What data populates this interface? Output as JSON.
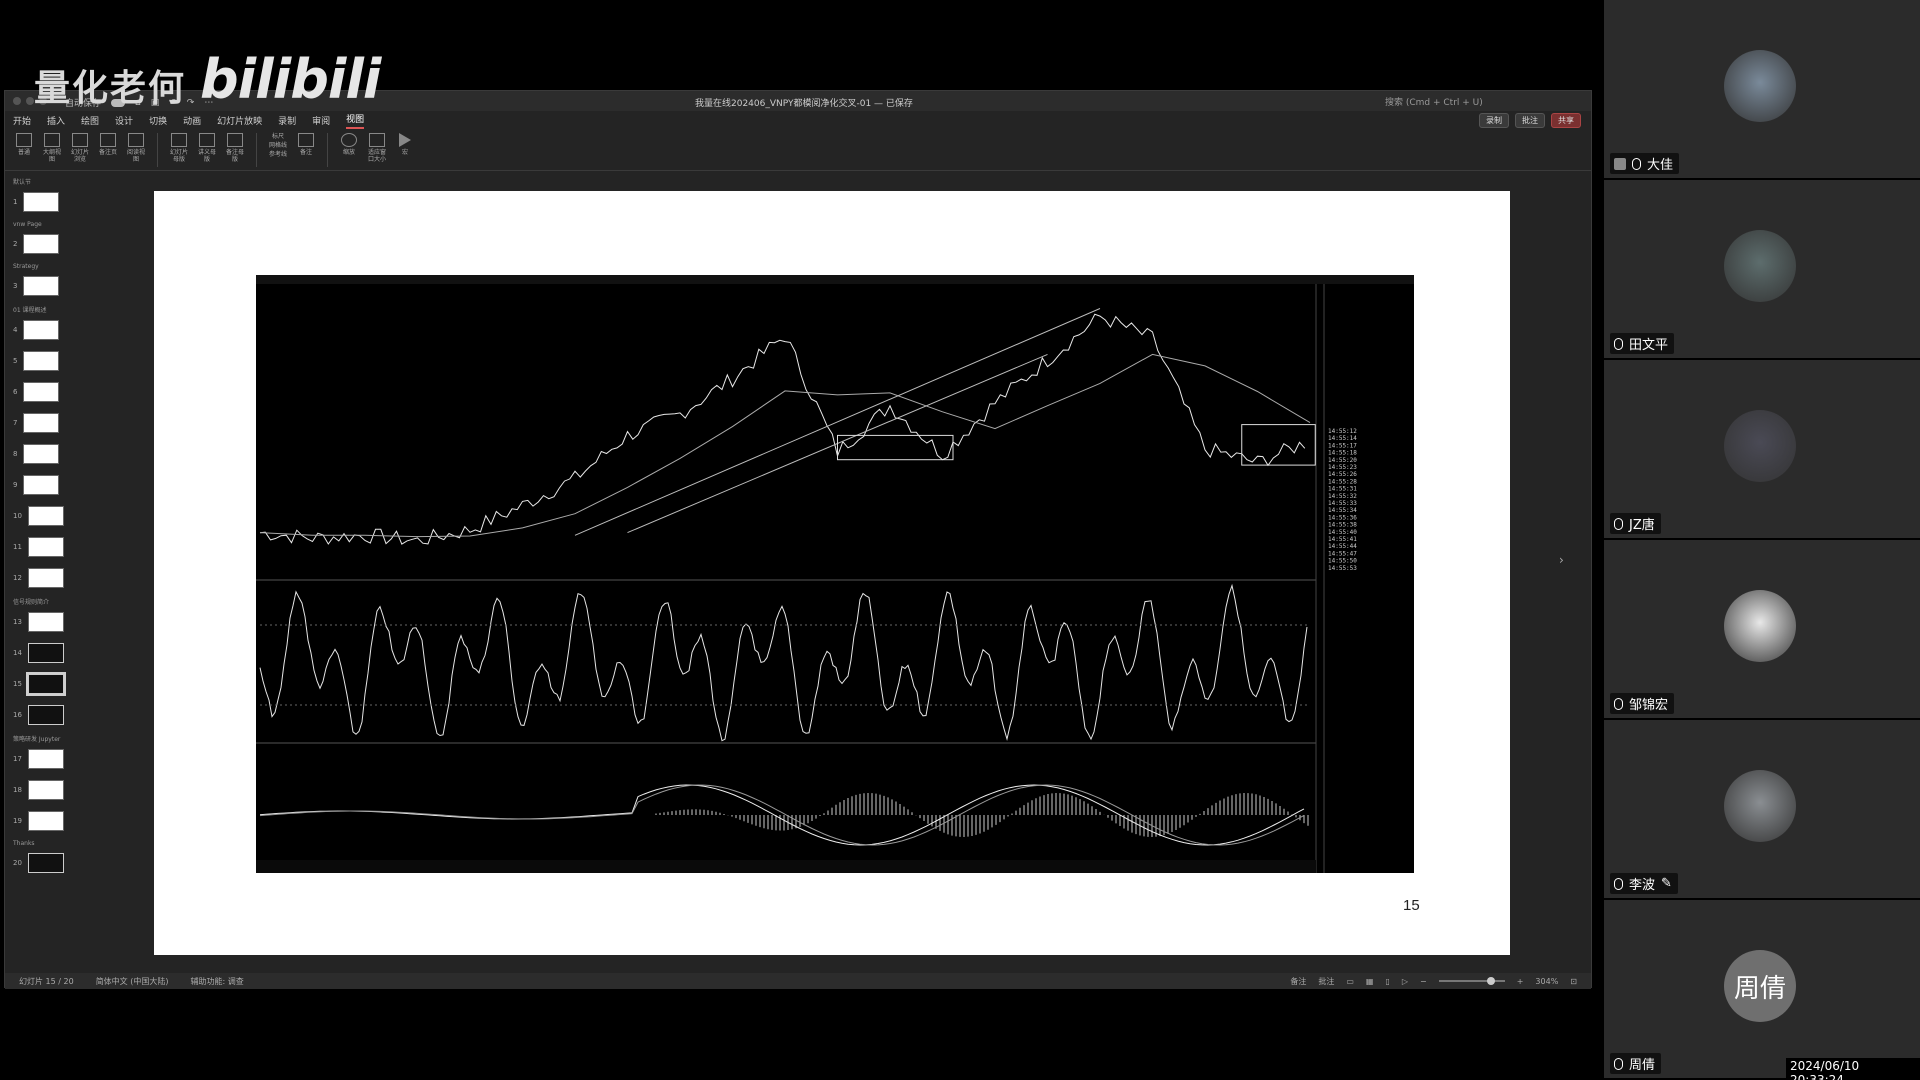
{
  "watermark": {
    "channel": "量化老何",
    "logo": "bilibili"
  },
  "ppt": {
    "title": "我量在线202406_VNPY都模阅净化交叉-01 — 已保存",
    "autosave_label": "自动保存",
    "search_placeholder": "搜索 (Cmd + Ctrl + U)",
    "menu": [
      "开始",
      "插入",
      "绘图",
      "设计",
      "切换",
      "动画",
      "幻灯片放映",
      "录制",
      "审阅",
      "视图"
    ],
    "active_menu": "视图",
    "right_buttons": {
      "record": "录制",
      "comments": "批注",
      "share": "共享"
    },
    "ribbon": [
      "普通",
      "大纲视图",
      "幻灯片浏览",
      "备注页",
      "阅读视图",
      "幻灯片母版",
      "讲义母版",
      "备注母版",
      "标尺",
      "网格线",
      "参考线",
      "备注",
      "缩放",
      "适应窗口大小",
      "宏"
    ],
    "sections": [
      {
        "label": "默认节",
        "slides": [
          1
        ]
      },
      {
        "label": "vnw Page",
        "slides": [
          2
        ]
      },
      {
        "label": "Strategy",
        "slides": [
          3
        ]
      },
      {
        "label": "01 课程概述",
        "slides": [
          4,
          5,
          6,
          7,
          8,
          9,
          10,
          11,
          12
        ]
      },
      {
        "label": "信号规则简介",
        "slides": [
          13,
          14,
          15,
          16
        ]
      },
      {
        "label": "策略研发 Jupyter",
        "slides": [
          17,
          18,
          19
        ]
      },
      {
        "label": "Thanks",
        "slides": [
          20
        ]
      }
    ],
    "selected_slide": 15,
    "slide_number": "15",
    "status": {
      "slide_pos": "幻灯片 15 / 20",
      "language": "简体中文 (中国大陆)",
      "accessibility": "辅助功能: 调查",
      "notes": "备注",
      "comments": "批注",
      "zoom": "304%"
    }
  },
  "chart_data": {
    "type": "line",
    "title": "",
    "panels": [
      {
        "name": "price",
        "x": [
          0,
          10,
          20,
          30,
          40,
          50,
          60,
          70,
          80,
          90,
          100,
          110,
          120,
          130,
          140,
          150,
          160,
          170,
          180,
          190,
          200
        ],
        "values": [
          3.2,
          3.0,
          3.1,
          2.9,
          3.3,
          4.2,
          5.2,
          6.8,
          7.6,
          8.9,
          10.5,
          6.2,
          7.9,
          6.1,
          8.0,
          9.6,
          11.2,
          10.4,
          6.3,
          5.8,
          6.6
        ]
      },
      {
        "name": "oscillator",
        "ylim": [
          -20,
          120
        ]
      },
      {
        "name": "macd"
      }
    ],
    "quote_times": [
      "14:55:12",
      "14:55:14",
      "14:55:17",
      "14:55:18",
      "14:55:20",
      "14:55:23",
      "14:55:26",
      "14:55:28",
      "14:55:31",
      "14:55:32",
      "14:55:33",
      "14:55:34",
      "14:55:36",
      "14:55:38",
      "14:55:40",
      "14:55:41",
      "14:55:44",
      "14:55:47",
      "14:55:50",
      "14:55:53"
    ]
  },
  "participants": [
    {
      "name": "大佳",
      "avatar": "photo-1",
      "host": true
    },
    {
      "name": "田文平",
      "avatar": "photo-2"
    },
    {
      "name": "JZ唐",
      "avatar": "photo-3"
    },
    {
      "name": "邹锦宏",
      "avatar": "photo-4"
    },
    {
      "name": "李波",
      "avatar": "photo-5",
      "editing": true
    },
    {
      "name": "周倩",
      "avatar_text": "周倩"
    }
  ],
  "timestamp": "2024/06/10 20:33:24",
  "colors": {
    "window_bg": "#242424",
    "slide_bg": "#ffffff",
    "tile_bg": "#2b2b2b",
    "chart_bg": "#000000"
  }
}
